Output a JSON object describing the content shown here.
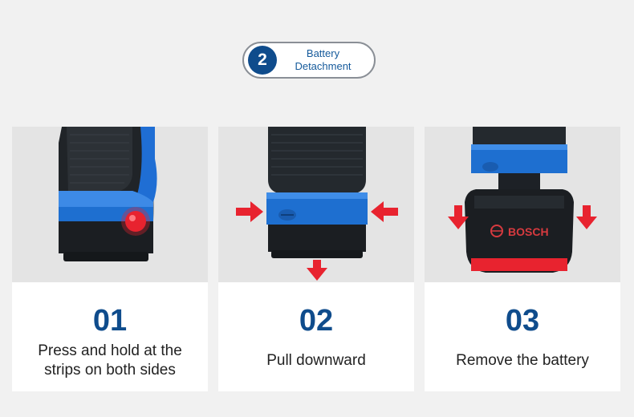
{
  "header": {
    "step_number": "2",
    "title_line1": "Battery",
    "title_line2": "Detachment"
  },
  "steps": [
    {
      "number": "01",
      "text_line1": "Press and hold at the",
      "text_line2": "strips on both sides"
    },
    {
      "number": "02",
      "text_line1": "Pull downward"
    },
    {
      "number": "03",
      "text_line1": "Remove the battery"
    }
  ],
  "brand_logo_text": "BOSCH",
  "colors": {
    "accent_blue": "#0f4c8c",
    "arrow_red": "#e8232f",
    "tool_blue": "#1e6fd0",
    "background": "#f1f1f1"
  },
  "icons": [
    "red-arrow-icon",
    "press-point-icon"
  ]
}
